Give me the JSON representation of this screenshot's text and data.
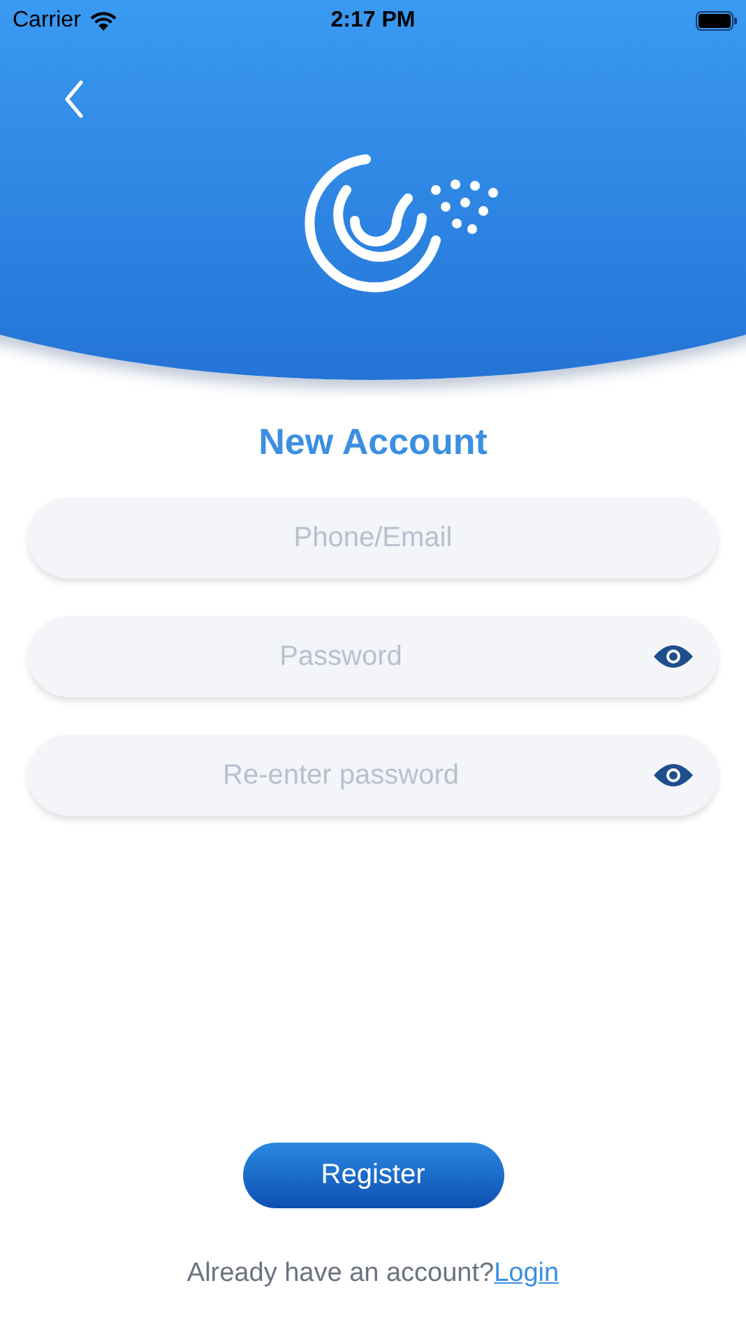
{
  "status_bar": {
    "carrier": "Carrier",
    "time": "2:17 PM"
  },
  "title": "New Account",
  "fields": [
    {
      "kind": "text",
      "placeholder": "Phone/Email"
    },
    {
      "kind": "password",
      "placeholder": "Password"
    },
    {
      "kind": "password",
      "placeholder": "Re-enter password"
    }
  ],
  "register_button": "Register",
  "footer": {
    "text": "Already have an account?",
    "link": "Login"
  }
}
